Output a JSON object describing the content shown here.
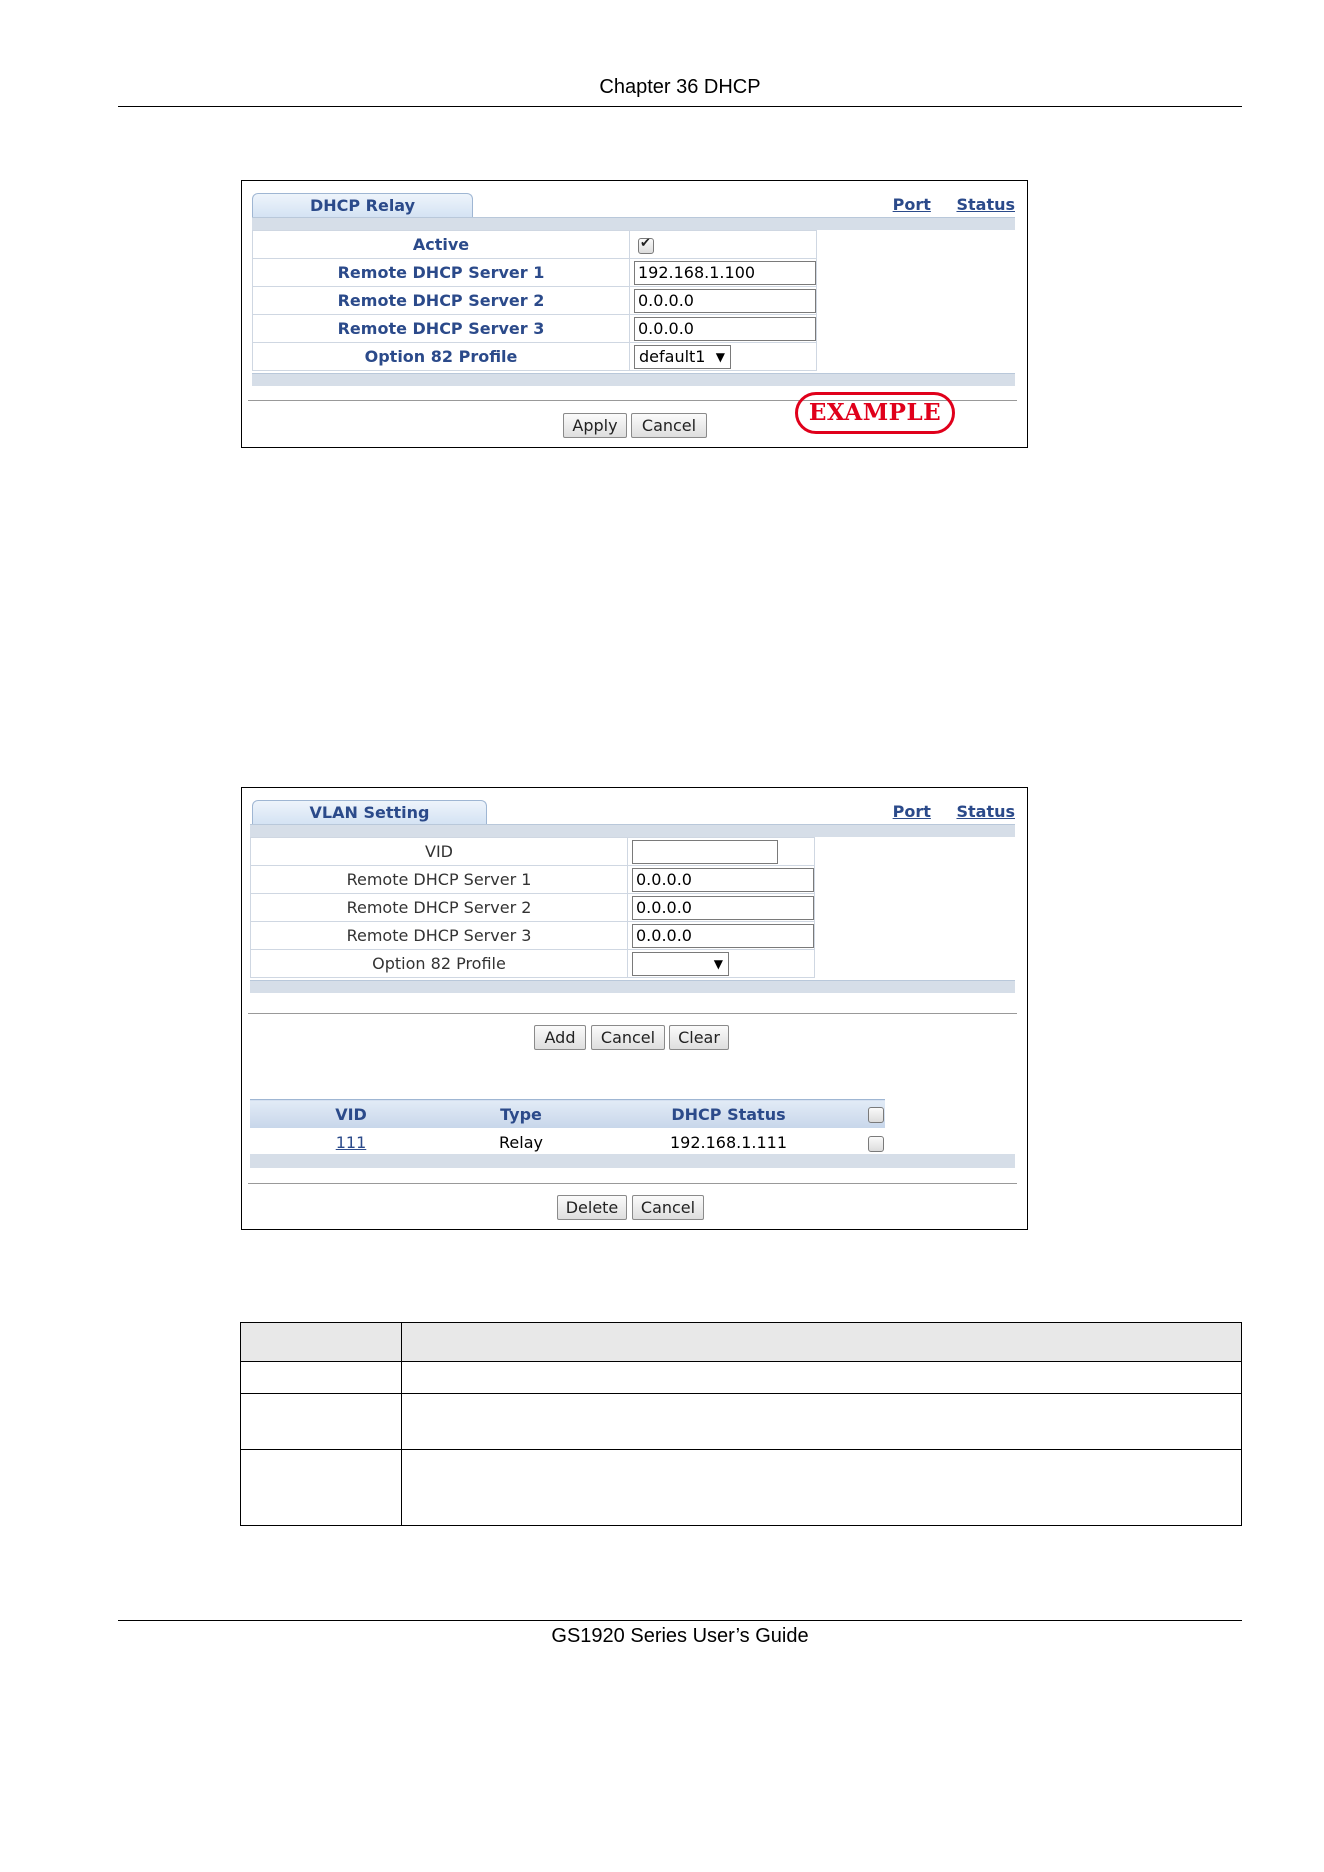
{
  "header": {
    "chapter": "Chapter 36 DHCP"
  },
  "footer": {
    "guide": "GS1920 Series User’s Guide"
  },
  "relay_screen": {
    "tab": "DHCP Relay",
    "links": [
      "Port",
      "Status"
    ],
    "fields": [
      {
        "label": "Active"
      },
      {
        "label": "Remote DHCP Server 1",
        "value": "192.168.1.100"
      },
      {
        "label": "Remote DHCP Server 2",
        "value": "0.0.0.0"
      },
      {
        "label": "Remote DHCP Server 3",
        "value": "0.0.0.0"
      },
      {
        "label": "Option 82 Profile",
        "value": "default1"
      }
    ],
    "active_checked": true,
    "buttons": {
      "apply": "Apply",
      "cancel": "Cancel"
    },
    "stamp": "EXAMPLE"
  },
  "vlan_screen": {
    "tab": "VLAN Setting",
    "links": [
      "Port",
      "Status"
    ],
    "fields": [
      {
        "label": "VID",
        "value": ""
      },
      {
        "label": "Remote DHCP Server 1",
        "value": "0.0.0.0"
      },
      {
        "label": "Remote DHCP Server 2",
        "value": "0.0.0.0"
      },
      {
        "label": "Remote DHCP Server 3",
        "value": "0.0.0.0"
      },
      {
        "label": "Option 82 Profile",
        "value": ""
      }
    ],
    "buttons": {
      "add": "Add",
      "cancel": "Cancel",
      "clear": "Clear",
      "delete": "Delete",
      "cancel2": "Cancel"
    },
    "list": {
      "columns": [
        "VID",
        "Type",
        "DHCP Status"
      ],
      "rows": [
        {
          "vid": "111",
          "type": "Relay",
          "status": "192.168.1.111"
        }
      ]
    }
  }
}
